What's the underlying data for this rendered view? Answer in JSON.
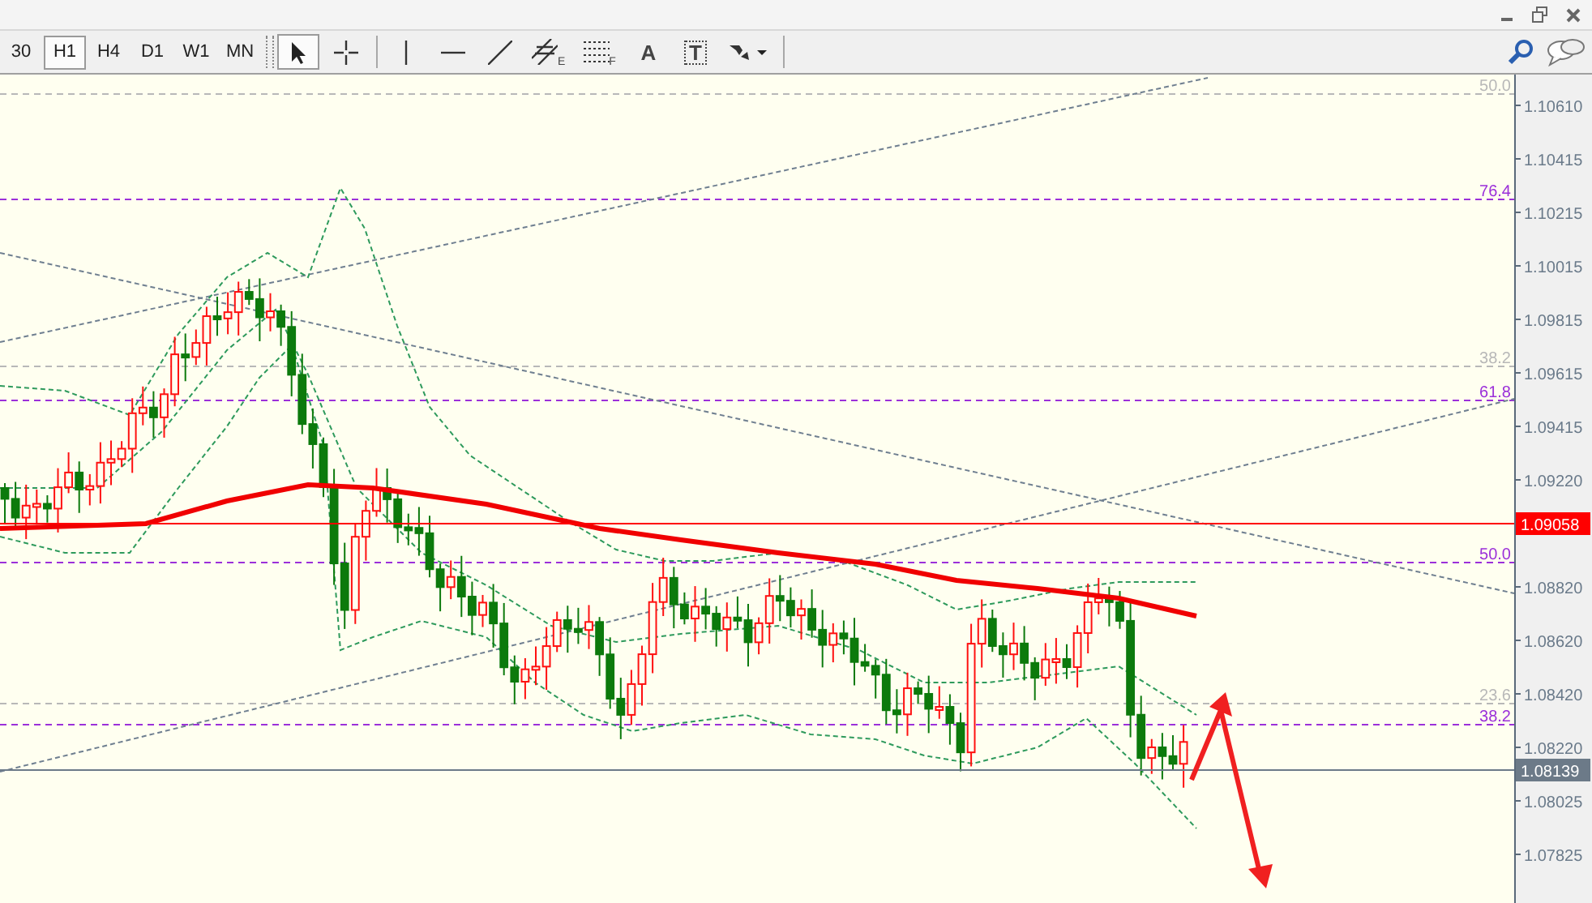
{
  "timeframes": [
    {
      "label": "30",
      "selected": false
    },
    {
      "label": "H1",
      "selected": true
    },
    {
      "label": "H4",
      "selected": false
    },
    {
      "label": "D1",
      "selected": false
    },
    {
      "label": "W1",
      "selected": false
    },
    {
      "label": "MN",
      "selected": false
    }
  ],
  "tools": [
    {
      "kind": "cursor",
      "selected": true
    },
    {
      "kind": "crosshair",
      "selected": false
    },
    {
      "kind": "vline",
      "selected": false
    },
    {
      "kind": "hline",
      "selected": false
    },
    {
      "kind": "trendline",
      "selected": false
    },
    {
      "kind": "channel",
      "glyph": "E",
      "selected": false
    },
    {
      "kind": "fibo",
      "glyph": "F",
      "selected": false
    },
    {
      "kind": "text",
      "glyph": "A",
      "selected": false
    },
    {
      "kind": "label",
      "glyph": "T",
      "selected": false
    },
    {
      "kind": "arrows",
      "selected": false
    }
  ],
  "price_axis": [
    "1.10610",
    "1.10415",
    "1.10215",
    "1.10015",
    "1.09815",
    "1.09615",
    "1.09415",
    "1.09220",
    "1.08820",
    "1.08620",
    "1.08420",
    "1.08220",
    "1.08025",
    "1.07825"
  ],
  "price_tags": [
    {
      "label": "1.09058",
      "kind": "line"
    },
    {
      "label": "1.08139",
      "kind": "bid"
    }
  ],
  "fib_levels": [
    {
      "label": "50.0",
      "color": "#b8b8b8"
    },
    {
      "label": "76.4",
      "color": "#9b30d9"
    },
    {
      "label": "38.2",
      "color": "#b8b8b8"
    },
    {
      "label": "61.8",
      "color": "#9b30d9"
    },
    {
      "label": "50.0",
      "color": "#9b30d9"
    },
    {
      "label": "23.6",
      "color": "#b8b8b8"
    },
    {
      "label": "38.2",
      "color": "#9b30d9"
    }
  ]
}
